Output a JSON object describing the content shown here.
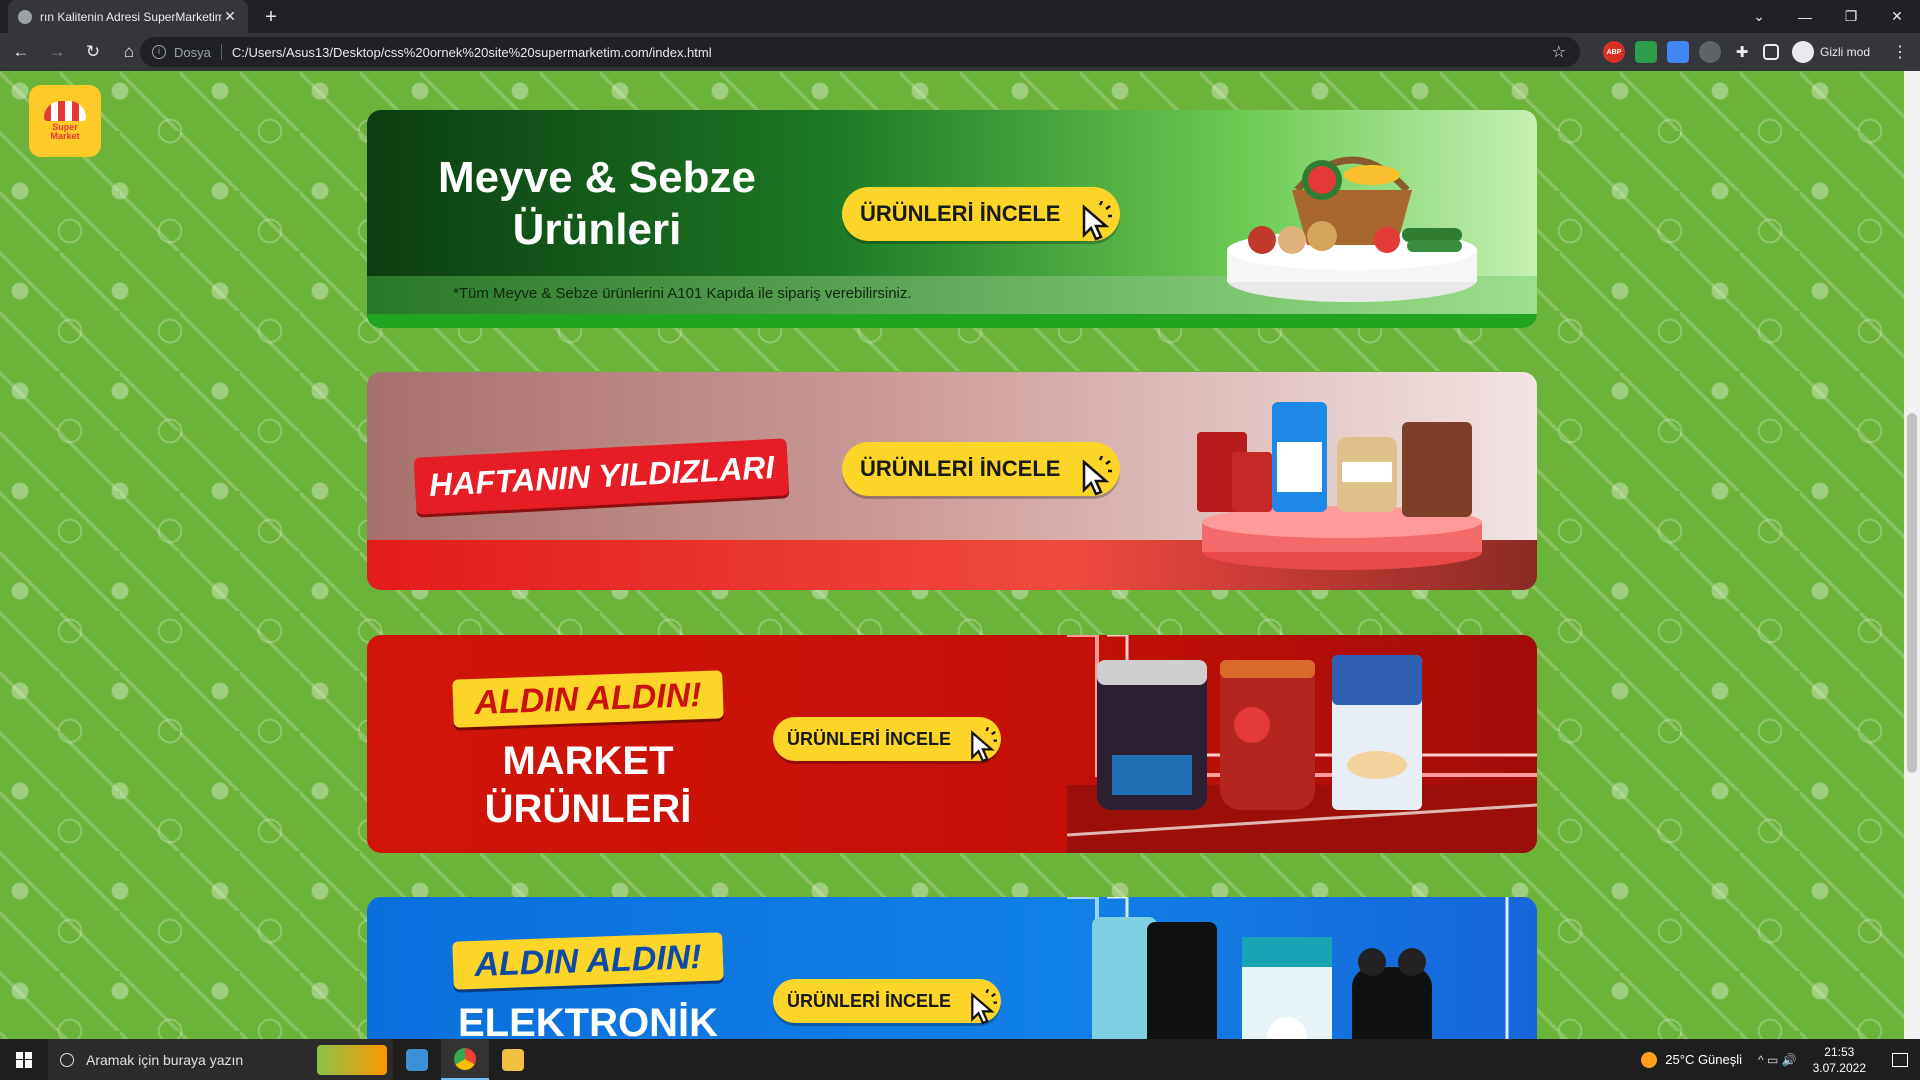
{
  "browser": {
    "tab_title": "rın Kalitenin Adresi SuperMarketim",
    "tab_close": "✕",
    "new_tab": "+",
    "scheme": "Dosya",
    "url": "C:/Users/Asus13/Desktop/css%20ornek%20site%20supermarketim.com/index.html",
    "profile_label": "Gizli mod",
    "extensions": [
      "ABP",
      "shield",
      "translate",
      "person",
      "puzzle",
      "sidebar"
    ]
  },
  "logo": {
    "text": "Super\nMarket"
  },
  "banners": {
    "fruits": {
      "title": "Meyve & Sebze Ürünleri",
      "note": "*Tüm Meyve & Sebze ürünlerini A101 Kapıda ile sipariş verebilirsiniz.",
      "cta": "ÜRÜNLERİ İNCELE"
    },
    "stars": {
      "tag": "HAFTANIN YILDIZLARI",
      "cta": "ÜRÜNLERİ İNCELE"
    },
    "market": {
      "tag": "ALDIN ALDIN!",
      "subtitle": "MARKET ÜRÜNLERİ",
      "cta": "ÜRÜNLERİ İNCELE"
    },
    "electronics": {
      "tag": "ALDIN ALDIN!",
      "subtitle": "ELEKTRONİK",
      "cta": "ÜRÜNLERİ İNCELE"
    }
  },
  "taskbar": {
    "search_placeholder": "Aramak için buraya yazın",
    "weather": "25°C  Güneşli",
    "time": "21:53",
    "date": "3.07.2022"
  },
  "colors": {
    "page_bg": "#6cb33a",
    "cta_yellow": "#fdd428",
    "banner_red": "#d21408",
    "banner_blue": "#0a6fdc"
  }
}
